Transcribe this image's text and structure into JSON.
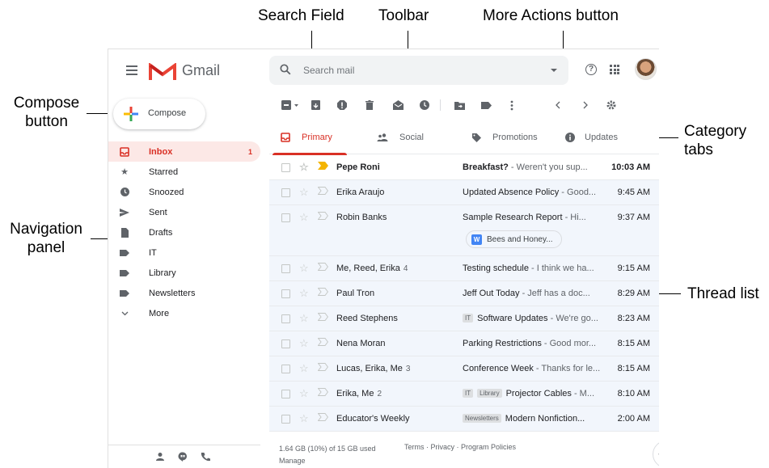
{
  "annotations": {
    "search_field": "Search Field",
    "toolbar": "Toolbar",
    "more_actions": "More Actions button",
    "compose_button": [
      "Compose",
      "button"
    ],
    "category_tabs": [
      "Category",
      "tabs"
    ],
    "navigation_panel": [
      "Navigation",
      "panel"
    ],
    "thread_list": "Thread list"
  },
  "header": {
    "app_name": "Gmail",
    "search_placeholder": "Search mail",
    "help_icon": "?"
  },
  "compose": {
    "label": "Compose"
  },
  "nav": [
    {
      "label": "Inbox",
      "icon": "inbox-icon",
      "count": "1",
      "active": true
    },
    {
      "label": "Starred",
      "icon": "star-icon"
    },
    {
      "label": "Snoozed",
      "icon": "clock-icon"
    },
    {
      "label": "Sent",
      "icon": "send-icon"
    },
    {
      "label": "Drafts",
      "icon": "draft-icon"
    },
    {
      "label": "IT",
      "icon": "label-icon"
    },
    {
      "label": "Library",
      "icon": "label-icon"
    },
    {
      "label": "Newsletters",
      "icon": "label-icon"
    },
    {
      "label": "More",
      "icon": "chevron-down-icon"
    }
  ],
  "tabs": [
    {
      "label": "Primary",
      "icon": "inbox-icon"
    },
    {
      "label": "Social",
      "icon": "people-icon"
    },
    {
      "label": "Promotions",
      "icon": "tag-icon"
    },
    {
      "label": "Updates",
      "icon": "info-icon"
    }
  ],
  "threads": [
    {
      "sender": "Pepe Roni",
      "count": "",
      "labels": [],
      "subject": "Breakfast?",
      "snippet": " - Weren't you sup...",
      "time": "10:03 AM",
      "unread": true,
      "important": true
    },
    {
      "sender": "Erika Araujo",
      "count": "",
      "labels": [],
      "subject": "Updated Absence Policy",
      "snippet": " - Good...",
      "time": "9:45 AM"
    },
    {
      "sender": "Robin Banks",
      "count": "",
      "labels": [],
      "subject": "Sample Research Report",
      "snippet": " - Hi...",
      "time": "9:37 AM",
      "attachment": "Bees and Honey..."
    },
    {
      "sender": "Me, Reed, Erika",
      "count": "4",
      "labels": [],
      "subject": "Testing schedule",
      "snippet": " - I think we ha...",
      "time": "9:15 AM"
    },
    {
      "sender": "Paul Tron",
      "count": "",
      "labels": [],
      "subject": "Jeff Out Today",
      "snippet": " - Jeff has a doc...",
      "time": "8:29 AM"
    },
    {
      "sender": "Reed Stephens",
      "count": "",
      "labels": [
        "IT"
      ],
      "subject": "Software Updates",
      "snippet": " - We're go...",
      "time": "8:23 AM"
    },
    {
      "sender": "Nena Moran",
      "count": "",
      "labels": [],
      "subject": "Parking Restrictions",
      "snippet": " - Good mor...",
      "time": "8:15 AM"
    },
    {
      "sender": "Lucas, Erika, Me",
      "count": "3",
      "labels": [],
      "subject": "Conference Week",
      "snippet": " - Thanks for le...",
      "time": "8:15 AM"
    },
    {
      "sender": "Erika, Me",
      "count": "2",
      "labels": [
        "IT",
        "Library"
      ],
      "subject": "Projector Cables",
      "snippet": " - M...",
      "time": "8:10 AM"
    },
    {
      "sender": "Educator's Weekly",
      "count": "",
      "labels": [
        "Newsletters"
      ],
      "subject": "Modern Nonfiction...",
      "snippet": "",
      "time": "2:00 AM"
    }
  ],
  "footer": {
    "storage": "1.64 GB (10%) of 15 GB used",
    "manage": "Manage",
    "links": "Terms · Privacy · Program Policies"
  },
  "colors": {
    "accent_red": "#d93025",
    "unread_bg": "#ffffff",
    "read_bg": "#f2f6fc",
    "important_yellow": "#f4b400"
  }
}
